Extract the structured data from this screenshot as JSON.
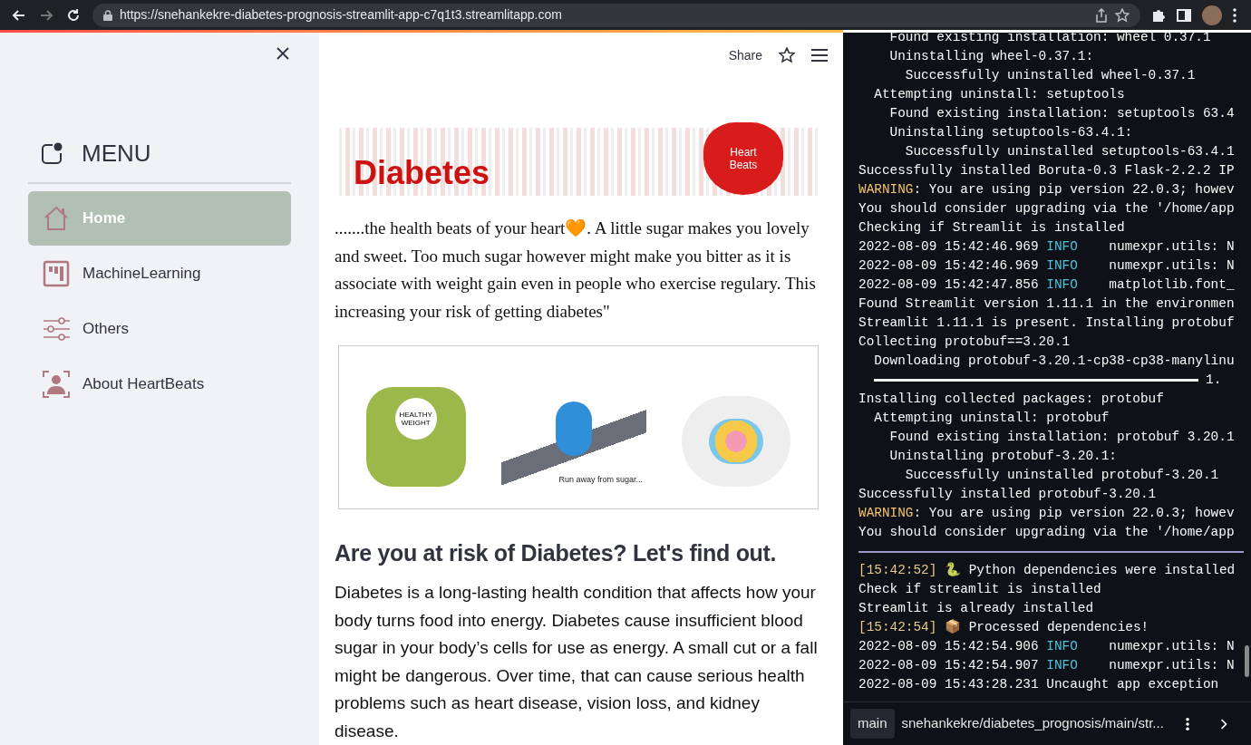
{
  "browser": {
    "url": "https://snehankekre-diabetes-prognosis-streamlit-app-c7q1t3.streamlitapp.com"
  },
  "sidebar": {
    "title": "MENU",
    "items": [
      {
        "label": "Home",
        "kind": "home",
        "selected": true
      },
      {
        "label": "MachineLearning",
        "kind": "board",
        "selected": false
      },
      {
        "label": "Others",
        "kind": "sliders",
        "selected": false
      },
      {
        "label": "About HeartBeats",
        "kind": "person",
        "selected": false
      }
    ]
  },
  "header": {
    "share": "Share"
  },
  "banner": {
    "title": "Diabetes",
    "badge": "Heart Beats"
  },
  "quote": ".......the health beats of your heart🧡. A little sugar makes you lovely and sweet. Too much sugar however might make you bitter as it is associate with weight gain even in people who exercise regulary. This increasing your risk of getting diabetes\"",
  "illustration": {
    "scale_label": "HEALTHY WEIGHT",
    "caption": "Run away from sugar..."
  },
  "heading": "Are you at risk of Diabetes? Let's find out.",
  "body": "Diabetes is a long-lasting health condition that affects how your body turns food into energy. Diabetes cause insufficient blood sugar in your body’s cells for use as energy. A small cut or a fall might be dangerous. Over time, that can cause serious health problems such as heart disease, vision loss, and kidney disease.",
  "terminal": {
    "lines": [
      {
        "kind": "plain",
        "text": "    Found existing installation: wheel 0.37.1"
      },
      {
        "kind": "plain",
        "text": "    Uninstalling wheel-0.37.1:"
      },
      {
        "kind": "plain",
        "text": "      Successfully uninstalled wheel-0.37.1"
      },
      {
        "kind": "plain",
        "text": "  Attempting uninstall: setuptools"
      },
      {
        "kind": "plain",
        "text": "    Found existing installation: setuptools 63.4"
      },
      {
        "kind": "plain",
        "text": "    Uninstalling setuptools-63.4.1:"
      },
      {
        "kind": "plain",
        "text": "      Successfully uninstalled setuptools-63.4.1"
      },
      {
        "kind": "plain",
        "text": "Successfully installed Boruta-0.3 Flask-2.2.2 IP"
      },
      {
        "kind": "mixed",
        "parts": [
          {
            "kind": "warn",
            "text": "WARNING"
          },
          {
            "kind": "plain",
            "text": ": You are using pip version 22.0.3; howev"
          }
        ]
      },
      {
        "kind": "plain",
        "text": "You should consider upgrading via the '/home/app"
      },
      {
        "kind": "plain",
        "text": "Checking if Streamlit is installed"
      },
      {
        "kind": "mixed",
        "parts": [
          {
            "kind": "plain",
            "text": "2022-08-09 15:42:46.969 "
          },
          {
            "kind": "info",
            "text": "INFO"
          },
          {
            "kind": "plain",
            "text": "    numexpr.utils: N"
          }
        ]
      },
      {
        "kind": "mixed",
        "parts": [
          {
            "kind": "plain",
            "text": "2022-08-09 15:42:46.969 "
          },
          {
            "kind": "info",
            "text": "INFO"
          },
          {
            "kind": "plain",
            "text": "    numexpr.utils: N"
          }
        ]
      },
      {
        "kind": "mixed",
        "parts": [
          {
            "kind": "plain",
            "text": "2022-08-09 15:42:47.856 "
          },
          {
            "kind": "info",
            "text": "INFO"
          },
          {
            "kind": "plain",
            "text": "    matplotlib.font_"
          }
        ]
      },
      {
        "kind": "plain",
        "text": "Found Streamlit version 1.11.1 in the environmen"
      },
      {
        "kind": "plain",
        "text": "Streamlit 1.11.1 is present. Installing protobuf"
      },
      {
        "kind": "plain",
        "text": "Collecting protobuf==3.20.1"
      },
      {
        "kind": "plain",
        "text": "  Downloading protobuf-3.20.1-cp38-cp38-manylinu"
      },
      {
        "kind": "progress",
        "level": 1,
        "text": "1."
      },
      {
        "kind": "plain",
        "text": "Installing collected packages: protobuf"
      },
      {
        "kind": "plain",
        "text": "  Attempting uninstall: protobuf"
      },
      {
        "kind": "plain",
        "text": "    Found existing installation: protobuf 3.20.1"
      },
      {
        "kind": "plain",
        "text": "    Uninstalling protobuf-3.20.1:"
      },
      {
        "kind": "plain",
        "text": "      Successfully uninstalled protobuf-3.20.1"
      },
      {
        "kind": "plain",
        "text": "Successfully installed protobuf-3.20.1"
      },
      {
        "kind": "mixed",
        "parts": [
          {
            "kind": "warn",
            "text": "WARNING"
          },
          {
            "kind": "plain",
            "text": ": You are using pip version 22.0.3; howev"
          }
        ]
      },
      {
        "kind": "plain",
        "text": "You should consider upgrading via the '/home/app"
      },
      {
        "kind": "divider"
      },
      {
        "kind": "mixed",
        "parts": [
          {
            "kind": "time",
            "text": "[15:42:52]"
          },
          {
            "kind": "plain",
            "text": " 🐍 Python dependencies were installed"
          }
        ]
      },
      {
        "kind": "plain",
        "text": "Check if streamlit is installed"
      },
      {
        "kind": "plain",
        "text": "Streamlit is already installed"
      },
      {
        "kind": "mixed",
        "parts": [
          {
            "kind": "time",
            "text": "[15:42:54]"
          },
          {
            "kind": "plain",
            "text": " 📦 Processed dependencies!"
          }
        ]
      },
      {
        "kind": "mixed",
        "parts": [
          {
            "kind": "plain",
            "text": "2022-08-09 15:42:54.906 "
          },
          {
            "kind": "info",
            "text": "INFO"
          },
          {
            "kind": "plain",
            "text": "    numexpr.utils: N"
          }
        ]
      },
      {
        "kind": "mixed",
        "parts": [
          {
            "kind": "plain",
            "text": "2022-08-09 15:42:54.907 "
          },
          {
            "kind": "info",
            "text": "INFO"
          },
          {
            "kind": "plain",
            "text": "    numexpr.utils: N"
          }
        ]
      },
      {
        "kind": "plain",
        "text": "2022-08-09 15:43:28.231 Uncaught app exception"
      }
    ],
    "branch": "main",
    "path": "snehankekre/diabetes_prognosis/main/str..."
  }
}
